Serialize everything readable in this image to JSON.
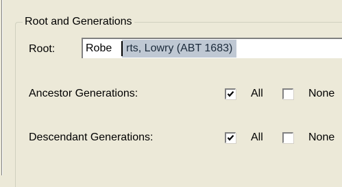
{
  "group": {
    "title": "Root and Generations"
  },
  "root": {
    "label": "Root:",
    "value_unselected": "Robe",
    "value_selected": "rts, Lowry (ABT 1683)"
  },
  "ancestor": {
    "label": "Ancestor Generations:",
    "all_label": "All",
    "all_checked": true,
    "none_label": "None",
    "none_checked": false
  },
  "descendant": {
    "label": "Descendant Generations:",
    "all_label": "All",
    "all_checked": true,
    "none_label": "None",
    "none_checked": false
  },
  "colors": {
    "dialog_bg": "#ece9d8",
    "selection_bg": "#bfc8d3"
  }
}
